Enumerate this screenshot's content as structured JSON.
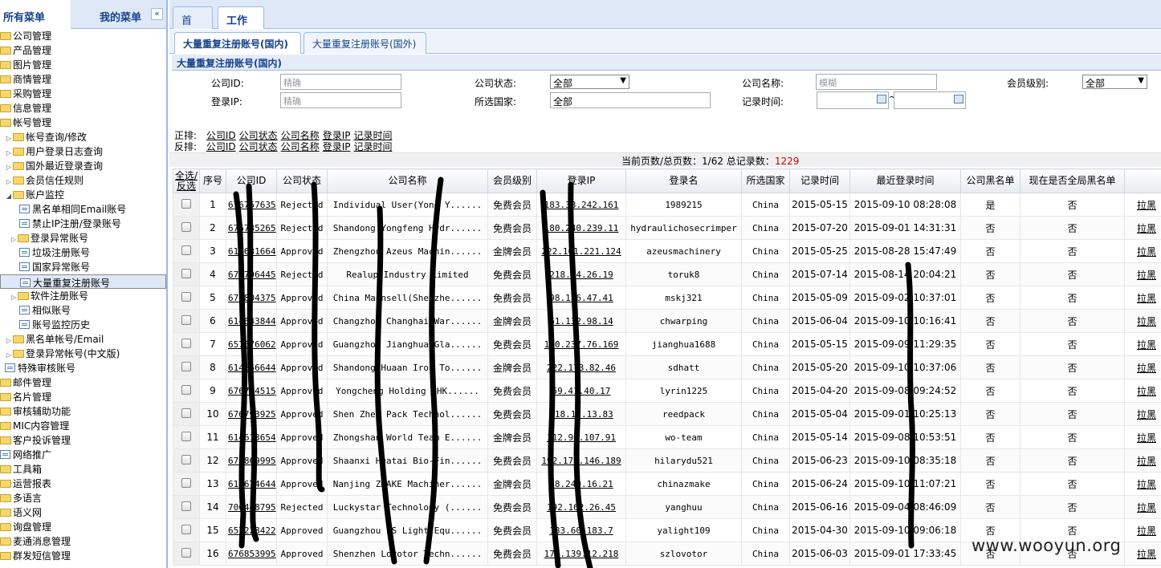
{
  "sidebar": {
    "tab_all": "所有菜单",
    "tab_mine": "我的菜单",
    "collapse_icon": "«",
    "items": [
      {
        "label": "公司管理",
        "level": 0
      },
      {
        "label": "产品管理",
        "level": 0
      },
      {
        "label": "图片管理",
        "level": 0
      },
      {
        "label": "商情管理",
        "level": 0
      },
      {
        "label": "采购管理",
        "level": 0
      },
      {
        "label": "信息管理",
        "level": 0
      },
      {
        "label": "帐号管理",
        "level": 0
      },
      {
        "label": "帐号查询/修改",
        "level": 1
      },
      {
        "label": "用户登录日志查询",
        "level": 1
      },
      {
        "label": "国外最近登录查询",
        "level": 1
      },
      {
        "label": "会员信任规则",
        "level": 1
      },
      {
        "label": "账户监控",
        "level": 1
      },
      {
        "label": "黑名单相同Email账号",
        "level": 2
      },
      {
        "label": "禁止IP注册/登录账号",
        "level": 2
      },
      {
        "label": "登录异常账号",
        "level": 2
      },
      {
        "label": "垃圾注册账号",
        "level": 2
      },
      {
        "label": "国家异常账号",
        "level": 2
      },
      {
        "label": "大量重复注册账号",
        "level": 2
      },
      {
        "label": "软件注册账号",
        "level": 2
      },
      {
        "label": "相似账号",
        "level": 2
      },
      {
        "label": "账号监控历史",
        "level": 2
      },
      {
        "label": "黑名单帐号/Email",
        "level": 1
      },
      {
        "label": "登录异常帐号(中文版)",
        "level": 1
      },
      {
        "label": "特殊审核账号",
        "level": 1
      },
      {
        "label": "邮件管理",
        "level": 0
      },
      {
        "label": "名片管理",
        "level": 0
      },
      {
        "label": "审核辅助功能",
        "level": 0
      },
      {
        "label": "MIC内容管理",
        "level": 0
      },
      {
        "label": "客户投诉管理",
        "level": 0
      },
      {
        "label": "网络推广",
        "level": 0
      },
      {
        "label": "工具箱",
        "level": 0
      },
      {
        "label": "运营报表",
        "level": 0
      },
      {
        "label": "多语言",
        "level": 0
      },
      {
        "label": "语义网",
        "level": 0
      },
      {
        "label": "询盘管理",
        "level": 0
      },
      {
        "label": "麦通消息管理",
        "level": 0
      },
      {
        "label": "群发短信管理",
        "level": 0
      }
    ]
  },
  "top_tabs": [
    "首 页",
    "工作区"
  ],
  "sub_tabs": [
    "大量重复注册账号(国内)",
    "大量重复注册账号(国外)"
  ],
  "panel_title": "大量重复注册账号(国内)",
  "filters": {
    "company_id_label": "公司ID:",
    "company_id_placeholder": "精确",
    "company_status_label": "公司状态:",
    "company_status_value": "全部",
    "company_name_label": "公司名称:",
    "company_name_placeholder": "模糊",
    "member_level_label": "会员级别:",
    "member_level_value": "全部",
    "login_ip_label": "登录IP:",
    "login_ip_placeholder": "精确",
    "country_label": "所选国家:",
    "country_value": "全部",
    "record_time_label": "记录时间:",
    "range_sep": "~"
  },
  "sort": {
    "asc_label": "正排:",
    "desc_label": "反排:",
    "fields": [
      "公司ID",
      "公司状态",
      "公司名称",
      "登录IP",
      "记录时间"
    ]
  },
  "pager": {
    "text": "当前页数/总页数：1/62 总记录数：",
    "total": "1229"
  },
  "table": {
    "headers": [
      "全选/反选",
      "序号",
      "公司ID",
      "公司状态",
      "公司名称",
      "会员级别",
      "登录IP",
      "登录名",
      "所选国家",
      "记录时间",
      "最近登录时间",
      "公司黑名单",
      "现在是否全局黑名单",
      ""
    ],
    "action_label": "拉黑",
    "rows": [
      [
        "1",
        "676757635",
        "Rejected",
        "Individual User(Yong Y......",
        "免费会员",
        "183.38.242.161",
        "1989215",
        "China",
        "2015-05-15",
        "2015-09-10 08:28:08",
        "是",
        "否"
      ],
      [
        "2",
        "676735265",
        "Rejected",
        "Shandong Yongfeng Hydr......",
        "免费会员",
        "180.240.239.11",
        "hydraulichosecrimper",
        "China",
        "2015-07-20",
        "2015-09-01 14:31:31",
        "否",
        "否"
      ],
      [
        "3",
        "614631664",
        "Approved",
        "Zhengzhou Azeus Machin......",
        "金牌会员",
        "222.161.221.124",
        "azeusmachinery",
        "China",
        "2015-05-25",
        "2015-08-28 15:47:49",
        "否",
        "否"
      ],
      [
        "4",
        "676796445",
        "Rejected",
        "Realup Industry Limited",
        "免费会员",
        "218.74.26.19",
        "toruk8",
        "China",
        "2015-07-14",
        "2015-08-14 20:04:21",
        "否",
        "否"
      ],
      [
        "5",
        "676804375",
        "Approved",
        "China Maunsell(Shenzhe......",
        "免费会员",
        "98.126.47.41",
        "mskj321",
        "China",
        "2015-05-09",
        "2015-09-02 10:37:01",
        "否",
        "否"
      ],
      [
        "6",
        "614643844",
        "Approved",
        "Changzhou Changhai War......",
        "金牌会员",
        "61.132.98.14",
        "chwarping",
        "China",
        "2015-06-04",
        "2015-09-10 10:16:41",
        "否",
        "否"
      ],
      [
        "7",
        "657676062",
        "Approved",
        "Guangzhou Jianghua Gla......",
        "免费会员",
        "120.237.76.169",
        "jianghua1688",
        "China",
        "2015-05-15",
        "2015-09-09 11:29:35",
        "否",
        "否"
      ],
      [
        "8",
        "614656644",
        "Approved",
        "Shandong Huaan Iron To......",
        "金牌会员",
        "222.173.82.46",
        "sdhatt",
        "China",
        "2015-05-20",
        "2015-09-10 10:37:06",
        "否",
        "否"
      ],
      [
        "9",
        "676764515",
        "Approved",
        "Yongcheng Holding (HK......",
        "免费会员",
        "59.41.40.17",
        "lyrin1225",
        "China",
        "2015-04-20",
        "2015-09-08 09:24:52",
        "否",
        "否"
      ],
      [
        "10",
        "676793925",
        "Approved",
        "Shen Zhen Pack Technol......",
        "免费会员",
        "218.17.13.83",
        "reedpack",
        "China",
        "2015-05-04",
        "2015-09-01 10:25:13",
        "否",
        "否"
      ],
      [
        "11",
        "614613654",
        "Approved",
        "Zhongshan World Team E......",
        "金牌会员",
        "112.96.107.91",
        "wo-team",
        "China",
        "2015-05-14",
        "2015-09-08 10:53:51",
        "否",
        "否"
      ],
      [
        "12",
        "676869995",
        "Approved",
        "Shaanxi Huatai Bio-Fin......",
        "免费会员",
        "192.173.146.189",
        "hilarydu521",
        "China",
        "2015-06-23",
        "2015-09-10 08:35:18",
        "否",
        "否"
      ],
      [
        "13",
        "614674644",
        "Approved",
        "Nanjing ZMAKE Machiner......",
        "金牌会员",
        "58.240.16.21",
        "chinazmake",
        "China",
        "2015-06-24",
        "2015-09-10 11:07:21",
        "否",
        "否"
      ],
      [
        "14",
        "700448795",
        "Rejected",
        "Luckystar Technology (......",
        "免费会员",
        "192.162.26.45",
        "yanghuu",
        "China",
        "2015-06-16",
        "2015-09-04 08:46:09",
        "否",
        "否"
      ],
      [
        "15",
        "657228422",
        "Approved",
        "Guangzhou LS Light Equ......",
        "免费会员",
        "183.60.183.7",
        "yalight109",
        "China",
        "2015-04-30",
        "2015-09-10 09:06:18",
        "否",
        "否"
      ],
      [
        "16",
        "676853995",
        "Approved",
        "Shenzhen Lovotor Techn......",
        "免费会员",
        "174.139.12.218",
        "szlovotor",
        "China",
        "2015-06-03",
        "2015-09-01 17:33:45",
        "否",
        "否"
      ]
    ]
  },
  "watermark": "www.wooyun.org"
}
